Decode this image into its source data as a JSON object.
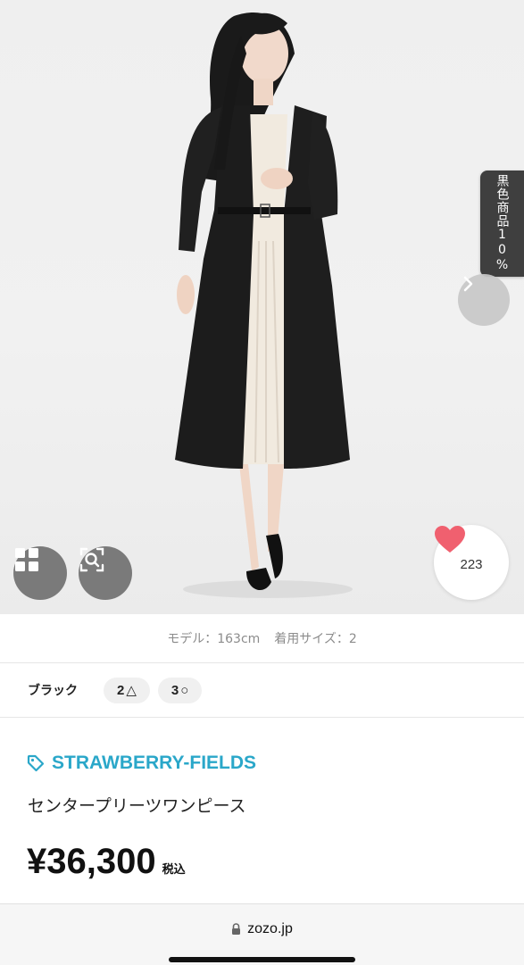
{
  "hero": {
    "side_tab_text": "黒色商品10%",
    "favorite_count": "223",
    "icons": {
      "next": "chevron-right-icon",
      "grid": "grid-icon",
      "zoom": "zoom-search-icon",
      "favorite": "heart-icon"
    }
  },
  "model_info": {
    "model_label": "モデル：163cm",
    "size_label": "着用サイズ：2"
  },
  "variant": {
    "color": "ブラック",
    "sizes": [
      {
        "size": "2",
        "stock": "△"
      },
      {
        "size": "3",
        "stock": "○"
      }
    ]
  },
  "product": {
    "brand": "STRAWBERRY-FIELDS",
    "name": "センタープリーツワンピース",
    "price": "¥36,300",
    "tax_label": "税込"
  },
  "browser": {
    "url": "zozo.jp"
  },
  "colors": {
    "brand_accent": "#2aa7c9",
    "heart": "#f0606f",
    "side_tab": "#3f3f3f"
  }
}
